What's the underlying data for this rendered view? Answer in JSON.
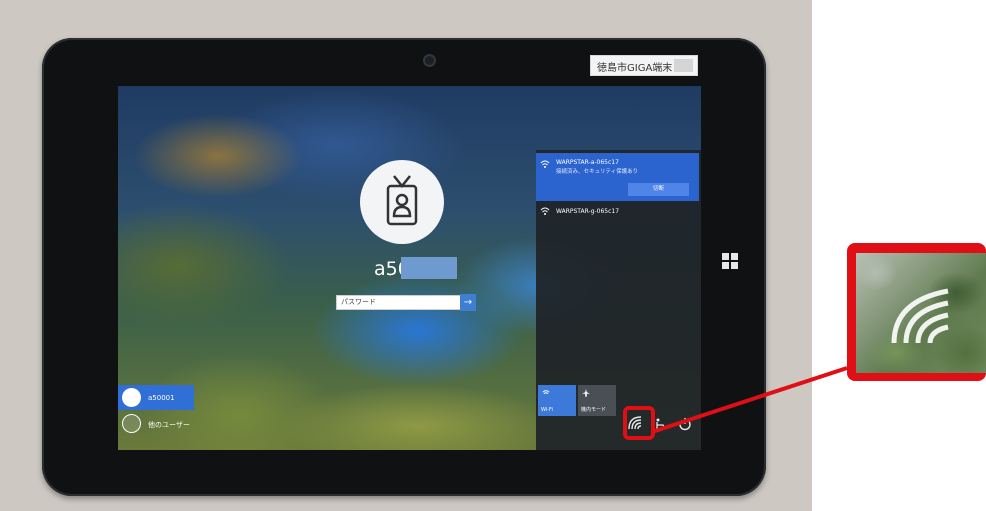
{
  "device": {
    "asset_label": "徳島市GIGA端末"
  },
  "lock_screen": {
    "username": "a50",
    "password_placeholder": "パスワード",
    "submit_arrow": "→",
    "user_list": [
      {
        "name": "a50001",
        "selected": true
      },
      {
        "name": "他のユーザー",
        "selected": false
      }
    ]
  },
  "network_panel": {
    "networks": [
      {
        "ssid": "WARPSTAR-a-065c17",
        "status": "接続済み、セキュリティ保護あり",
        "connected": true
      },
      {
        "ssid": "WARPSTAR-g-065c17",
        "status": "",
        "connected": false
      }
    ],
    "disconnect_label": "切断",
    "quick_actions": [
      {
        "label": "Wi-Fi",
        "active": true
      },
      {
        "label": "機内モード",
        "active": false
      }
    ]
  },
  "annotation": {
    "highlight": "wifi-tray-icon",
    "callout_color": "#e00f16"
  },
  "colors": {
    "accent": "#2b63cf",
    "tile_inactive": "#4a4f55"
  }
}
